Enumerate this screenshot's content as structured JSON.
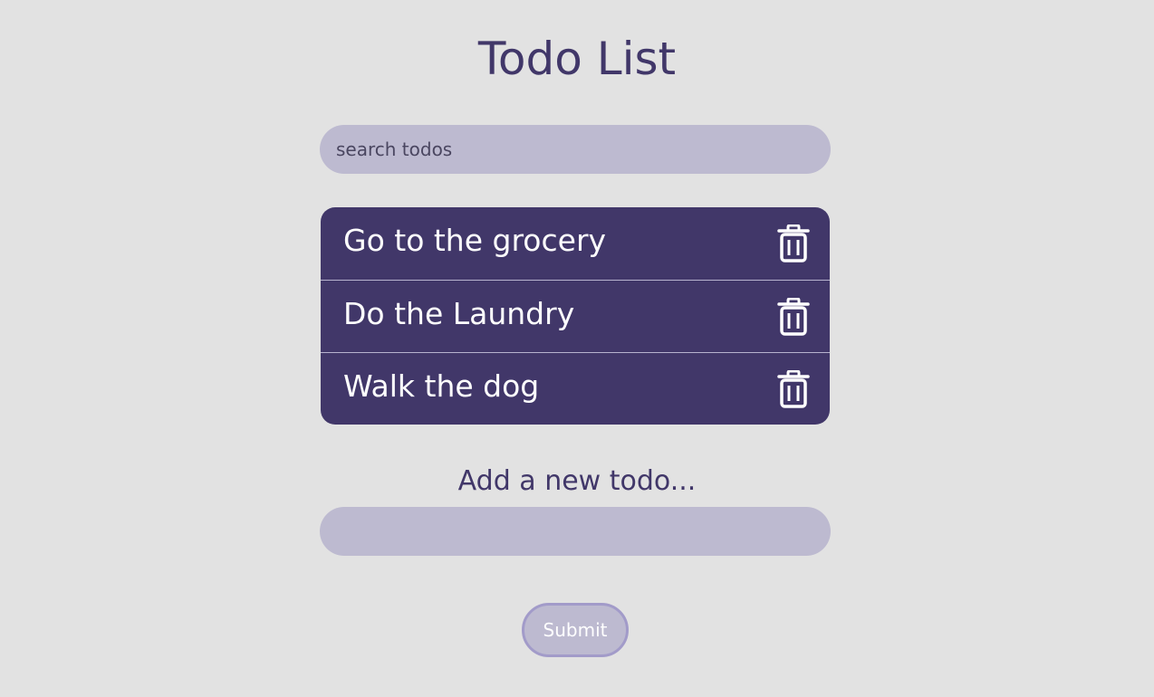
{
  "header": {
    "title": "Todo List"
  },
  "search": {
    "placeholder": "search todos",
    "value": ""
  },
  "todos": [
    {
      "text": "Go to the grocery",
      "action_icon": "trash-icon"
    },
    {
      "text": "Do the Laundry",
      "action_icon": "trash-icon"
    },
    {
      "text": "Walk the dog",
      "action_icon": "trash-icon"
    }
  ],
  "add_form": {
    "label": "Add a new todo...",
    "input_value": "",
    "submit_label": "Submit"
  },
  "colors": {
    "background": "#e2e2e2",
    "accent": "#413769",
    "input_fill": "#bdbad0",
    "button_border": "#a29bc9",
    "item_text": "#ffffff"
  }
}
